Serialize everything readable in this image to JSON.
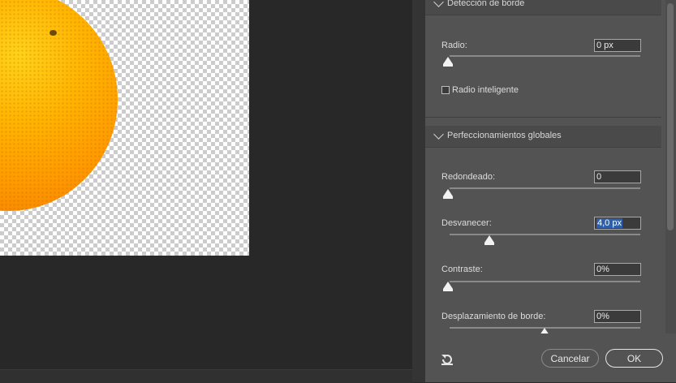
{
  "sections": {
    "edge_detection": {
      "title": "Detección de borde",
      "radius": {
        "label": "Radio:",
        "value": "0 px",
        "slider_fraction": 0.0
      },
      "smart_radius": {
        "label": "Radio inteligente",
        "checked": false
      }
    },
    "global_refinements": {
      "title": "Perfeccionamientos globales",
      "smooth": {
        "label": "Redondeado:",
        "value": "0",
        "slider_fraction": 0.0
      },
      "feather": {
        "label": "Desvanecer:",
        "value": "4,0 px",
        "slider_fraction": 0.2
      },
      "contrast": {
        "label": "Contraste:",
        "value": "0%",
        "slider_fraction": 0.0
      },
      "shift_edge": {
        "label": "Desplazamiento de borde:",
        "value": "0%",
        "slider_fraction": 0.5
      }
    }
  },
  "footer": {
    "cancel_label": "Cancelar",
    "ok_label": "OK",
    "reset_icon": "reset-icon"
  },
  "colors": {
    "panel": "#535353",
    "canvas": "#282828",
    "selection": "#2f5fa8"
  }
}
